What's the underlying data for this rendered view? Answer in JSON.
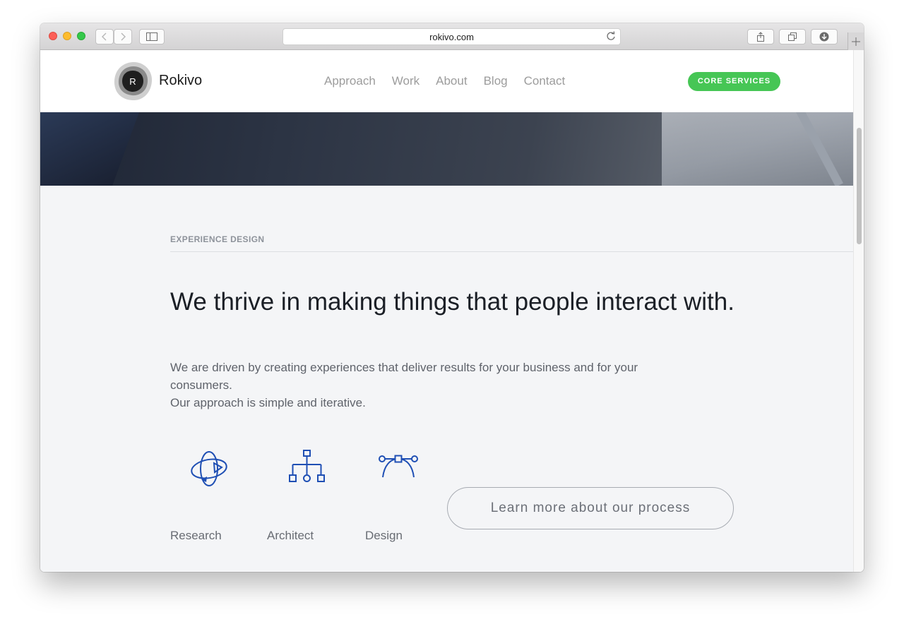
{
  "browser": {
    "url": "rokivo.com"
  },
  "site": {
    "logo_initial": "R",
    "logo_text": "Rokivo",
    "nav": [
      "Approach",
      "Work",
      "About",
      "Blog",
      "Contact"
    ],
    "cta_label": "CORE SERVICES"
  },
  "section": {
    "label": "EXPERIENCE DESIGN",
    "headline": "We thrive in making things that people interact with.",
    "body_line1": "We are driven by creating experiences that deliver results for your business and for your consumers.",
    "body_line2": "Our approach is simple and iterative.",
    "features": [
      {
        "label": "Research",
        "icon": "orbit-icon"
      },
      {
        "label": "Architect",
        "icon": "sitemap-icon"
      },
      {
        "label": "Design",
        "icon": "bezier-curve-icon"
      }
    ],
    "button_label": "Learn more about our process"
  },
  "colors": {
    "accent_green": "#46c655",
    "icon_blue": "#1f4fb4"
  }
}
